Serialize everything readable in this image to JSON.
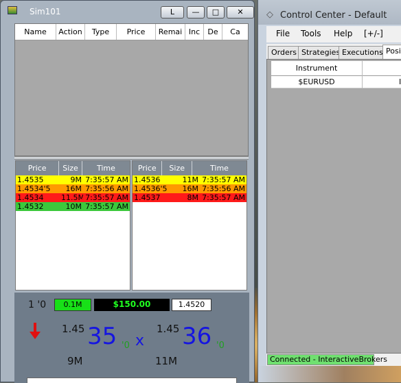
{
  "sim_window": {
    "title": "Sim101",
    "buttons": {
      "lock": "L",
      "minimize": "—",
      "maximize": "□",
      "close": "✕"
    },
    "orders_columns": [
      "Name",
      "Action",
      "Type",
      "Price",
      "Remai",
      "Inc",
      "De",
      "Ca"
    ],
    "bid_ladder": {
      "columns": [
        "Price",
        "Size",
        "Time"
      ],
      "rows": [
        {
          "price": "1.4535",
          "size": "9M",
          "time": "7:35:57 AM",
          "color": "#ffff00"
        },
        {
          "price": "1.4534'5",
          "size": "16M",
          "time": "7:35:56 AM",
          "color": "#ff9a00"
        },
        {
          "price": "1.4534",
          "size": "11.5M",
          "time": "7:35:57 AM",
          "color": "#ff1a1a"
        },
        {
          "price": "1.4532",
          "size": "10M",
          "time": "7:35:57 AM",
          "color": "#3cc83c"
        }
      ]
    },
    "ask_ladder": {
      "columns": [
        "Price",
        "Size",
        "Time"
      ],
      "rows": [
        {
          "price": "1.4536",
          "size": "11M",
          "time": "7:35:57 AM",
          "color": "#ffff00"
        },
        {
          "price": "1.4536'5",
          "size": "16M",
          "time": "7:35:56 AM",
          "color": "#ff9a00"
        },
        {
          "price": "1.4537",
          "size": "8M",
          "time": "7:35:57 AM",
          "color": "#ff1a1a"
        }
      ]
    },
    "position": {
      "label": "1 '0",
      "quantity": "0.1M",
      "pnl": "$150.00",
      "price": "1.4520"
    },
    "bid_quote": {
      "prefix": "1.45",
      "big": "35",
      "small": "'0",
      "size": "9M"
    },
    "ask_quote": {
      "prefix": "1.45",
      "big": "36",
      "small": "'0",
      "size": "11M"
    },
    "separator": "x",
    "trend_icon": "arrow-down-icon",
    "trend_color": "#e01010"
  },
  "control_center": {
    "title": "Control Center - Default",
    "menu": [
      "File",
      "Tools",
      "Help",
      "[+/-]"
    ],
    "tabs": [
      "Orders",
      "Strategies",
      "Executions",
      "Positi"
    ],
    "active_tab": "Positi",
    "grid_header": "Instrument",
    "rows": [
      {
        "instrument": "$EURUSD",
        "extra": "I"
      }
    ],
    "status": "Connected - InteractiveBrokers"
  }
}
